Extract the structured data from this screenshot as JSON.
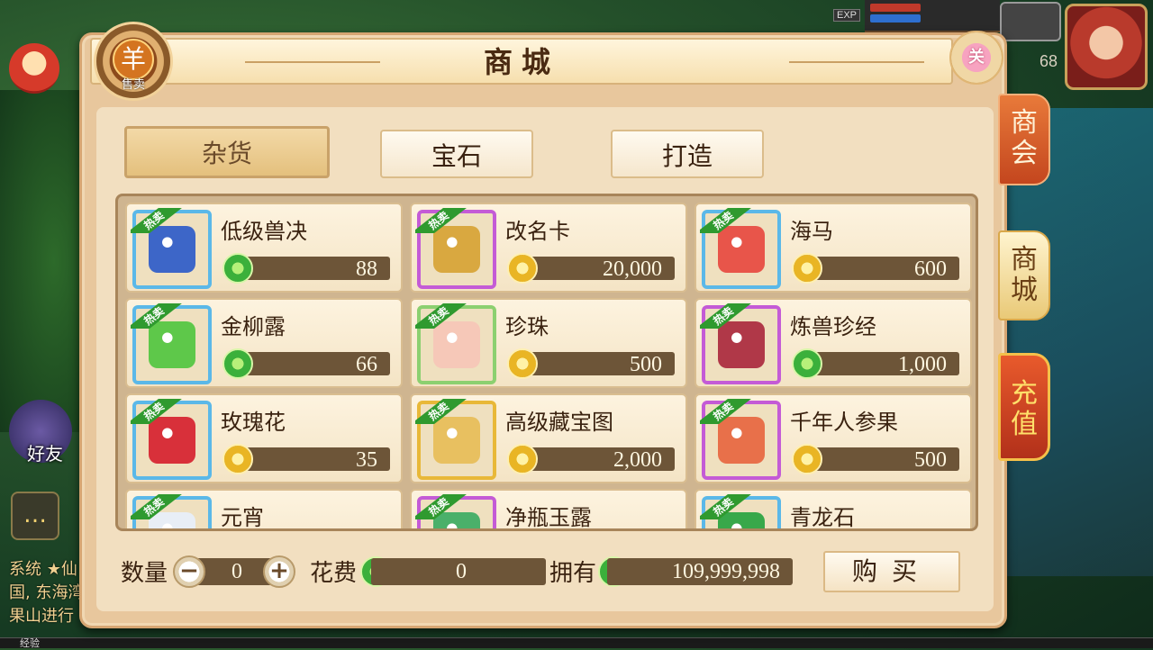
{
  "hud": {
    "exp_tag": "EXP",
    "level": "68",
    "friend_label": "好友",
    "chat_icon": "chat-bubble-icon",
    "chat_lines": [
      "系统 ★仙",
      "国, 东海湾",
      "果山进行"
    ],
    "exp_bar_label": "经验"
  },
  "panel": {
    "title": "商城",
    "sell_button": {
      "glyph": "羊",
      "label": "售卖"
    },
    "close_button": {
      "label": "关"
    }
  },
  "category_tabs": [
    {
      "label": "杂货",
      "active": true
    },
    {
      "label": "宝石",
      "active": false
    },
    {
      "label": "打造",
      "active": false
    }
  ],
  "items": [
    {
      "name": "低级兽决",
      "price": "88",
      "currency": "jade",
      "frame": "blue",
      "hot": "热卖",
      "icon": "skill-book-icon"
    },
    {
      "name": "改名卡",
      "price": "20,000",
      "currency": "gold",
      "frame": "purple",
      "hot": "热卖",
      "icon": "rename-scroll-icon"
    },
    {
      "name": "海马",
      "price": "600",
      "currency": "gold",
      "frame": "blue",
      "hot": "热卖",
      "icon": "seahorse-icon"
    },
    {
      "name": "金柳露",
      "price": "66",
      "currency": "jade",
      "frame": "blue",
      "hot": "热卖",
      "icon": "potion-bottle-icon"
    },
    {
      "name": "珍珠",
      "price": "500",
      "currency": "gold",
      "frame": "green",
      "hot": "热卖",
      "icon": "pearl-icon"
    },
    {
      "name": "炼兽珍经",
      "price": "1,000",
      "currency": "jade",
      "frame": "purple",
      "hot": "热卖",
      "icon": "red-book-icon"
    },
    {
      "name": "玫瑰花",
      "price": "35",
      "currency": "gold",
      "frame": "blue",
      "hot": "热卖",
      "icon": "rose-icon"
    },
    {
      "name": "高级藏宝图",
      "price": "2,000",
      "currency": "gold",
      "frame": "gold",
      "hot": "热卖",
      "icon": "treasure-map-icon"
    },
    {
      "name": "千年人参果",
      "price": "500",
      "currency": "gold",
      "frame": "purple",
      "hot": "热卖",
      "icon": "ginseng-fruit-icon"
    },
    {
      "name": "元宵",
      "price": "",
      "currency": "",
      "frame": "blue",
      "hot": "热卖",
      "icon": "rice-ball-icon"
    },
    {
      "name": "净瓶玉露",
      "price": "",
      "currency": "",
      "frame": "purple",
      "hot": "热卖",
      "icon": "jade-vase-icon"
    },
    {
      "name": "青龙石",
      "price": "",
      "currency": "",
      "frame": "blue",
      "hot": "热卖",
      "icon": "green-dragon-stone-icon"
    }
  ],
  "footer": {
    "qty_label": "数量",
    "qty_value": "0",
    "minus": "−",
    "plus": "+",
    "cost_label": "花费",
    "cost_value": "0",
    "own_label": "拥有",
    "own_value": "109,999,998",
    "buy_label": "购买"
  },
  "side_tabs": [
    {
      "label": "商会"
    },
    {
      "label": "商城"
    },
    {
      "label": "充值"
    }
  ],
  "colors": {
    "jade": "#3bb03b",
    "gold": "#e9b524",
    "panel": "#e8c79d",
    "price_bar": "#6d5538"
  }
}
